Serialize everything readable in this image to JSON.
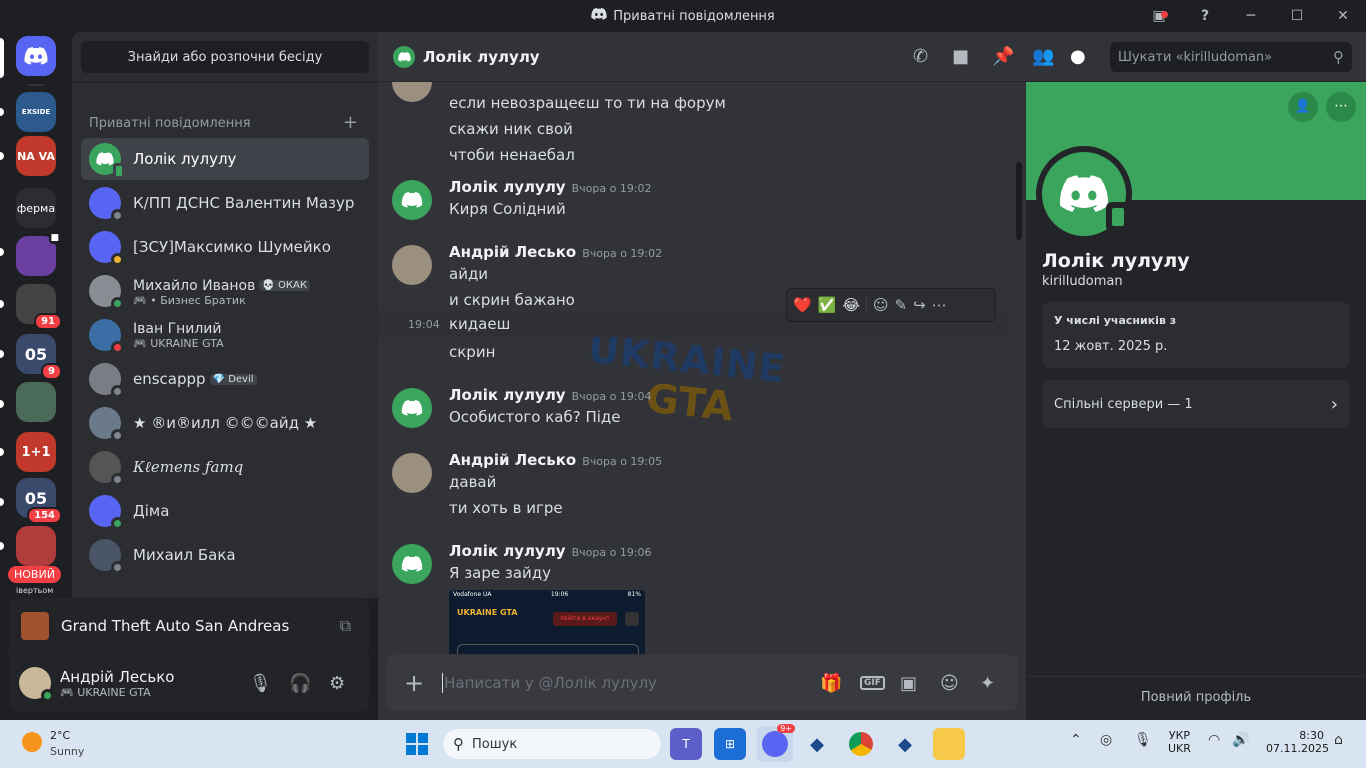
{
  "window": {
    "title": "Приватні повідомлення"
  },
  "servers": {
    "items": [
      {
        "label": "",
        "color": "#5865f2",
        "badge": ""
      },
      {
        "label": "EXSIDE",
        "color": "#2c5a8c",
        "badge": ""
      },
      {
        "label": "NA VA",
        "color": "#c0392b",
        "badge": ""
      },
      {
        "label": "ферма",
        "color": "#2b2d31",
        "badge": ""
      },
      {
        "label": "",
        "color": "#6a3fa0",
        "badge": ""
      },
      {
        "label": "",
        "color": "#444",
        "badge": "91"
      },
      {
        "label": "05",
        "color": "#3a4a6a",
        "badge": "9"
      },
      {
        "label": "",
        "color": "#4a6a5a",
        "badge": ""
      },
      {
        "label": "1+1",
        "color": "#c0392b",
        "badge": ""
      },
      {
        "label": "05",
        "color": "#3a4a6a",
        "badge": "154"
      },
      {
        "label": "",
        "color": "#b23c3c",
        "badge": ""
      }
    ],
    "new_label": "НОВИЙ",
    "bottom_label": "івертьом"
  },
  "dm": {
    "find_label": "Знайди або розпочни бесіду",
    "header": "Приватні повідомлення",
    "add_icon": "+",
    "items": [
      {
        "name": "Лолік лулулу",
        "sub": "",
        "tag": "",
        "color": "#3ba55d",
        "status": "#3ba55d"
      },
      {
        "name": "К/ПП ДСНС Валентин Мазур",
        "sub": "",
        "tag": "",
        "color": "#5865f2",
        "status": "#80848e"
      },
      {
        "name": "[ЗСУ]Максимко Шумейко",
        "sub": "",
        "tag": "",
        "color": "#5865f2",
        "status": "#f0b232"
      },
      {
        "name": "Михайло Иванов",
        "sub": "• Бизнес Братик",
        "tag": "💀 ОКАК",
        "color": "#8a8e94",
        "status": "#3ba55d"
      },
      {
        "name": "Іван Гнилий",
        "sub": "UKRAINE GTA",
        "tag": "",
        "color": "#3a6ea5",
        "status": "#f23f43"
      },
      {
        "name": "enscappp",
        "sub": "",
        "tag": "💎 Devil",
        "color": "#7a7d85",
        "status": "#80848e"
      },
      {
        "name": "★ ®и®илл ©©©айд ★",
        "sub": "",
        "tag": "",
        "color": "#6b7a8a",
        "status": "#80848e"
      },
      {
        "name": "Кℓemenѕ ƒamq",
        "sub": "",
        "tag": "",
        "color": "#555",
        "status": "#80848e"
      },
      {
        "name": "Діма",
        "sub": "",
        "tag": "",
        "color": "#5865f2",
        "status": "#3ba55d"
      },
      {
        "name": "Михаил Бака",
        "sub": "",
        "tag": "",
        "color": "#4a5568",
        "status": "#80848e"
      }
    ]
  },
  "game_activity": {
    "title": "Grand Theft Auto San Andreas"
  },
  "user": {
    "name": "Андрій Лесько",
    "status": "UKRAINE GTA"
  },
  "chat": {
    "title": "Лолік лулулу",
    "search_placeholder": "Шукати «kirilludoman»",
    "input_placeholder": "Написати у @Лолік лулулу",
    "hover_time": "19:04",
    "reactions": [
      "❤️",
      "✅",
      "😂"
    ],
    "messages": [
      {
        "author": "",
        "time": "",
        "lines": [
          "если невозращеєш то ти на форум",
          "скажи ник свой",
          "чтоби ненаебал"
        ],
        "avatar": "hamster"
      },
      {
        "author": "Лолік лулулу",
        "time": "Вчора о 19:02",
        "lines": [
          "Киря Солідний"
        ],
        "avatar": "discord"
      },
      {
        "author": "Андрій Лесько",
        "time": "Вчора о 19:02",
        "lines": [
          "айди",
          "и скрин бажано",
          "кидаеш",
          "скрин"
        ],
        "avatar": "hamster"
      },
      {
        "author": "Лолік лулулу",
        "time": "Вчора о 19:04",
        "lines": [
          "Особистого каб? Піде"
        ],
        "avatar": "discord"
      },
      {
        "author": "Андрій Лесько",
        "time": "Вчора о 19:05",
        "lines": [
          "давай",
          "ти  хоть в игре"
        ],
        "avatar": "hamster"
      },
      {
        "author": "Лолік лулулу",
        "time": "Вчора о 19:06",
        "lines": [
          "Я заре зайду"
        ],
        "avatar": "discord"
      }
    ],
    "watermark": [
      "UKRAINE",
      "GTA"
    ],
    "attachment": {
      "status_left": "Vodafone UA",
      "status_time": "19:06",
      "status_right": "81%",
      "logo": "UKRAINE GTA",
      "button": "Увійти в акаунт"
    }
  },
  "profile": {
    "name": "Лолік лулулу",
    "username": "kirilludoman",
    "member_since_label": "У числі учасників з",
    "member_since": "12 жовт. 2025 р.",
    "mutual_servers": "Спільні сервери — 1",
    "full_profile": "Повний профіль"
  },
  "taskbar": {
    "weather_temp": "2°C",
    "weather_desc": "Sunny",
    "search": "Пошук",
    "lang_top": "УКР",
    "lang_bottom": "UKR",
    "time": "8:30",
    "date": "07.11.2025",
    "discord_badge": "9+"
  }
}
